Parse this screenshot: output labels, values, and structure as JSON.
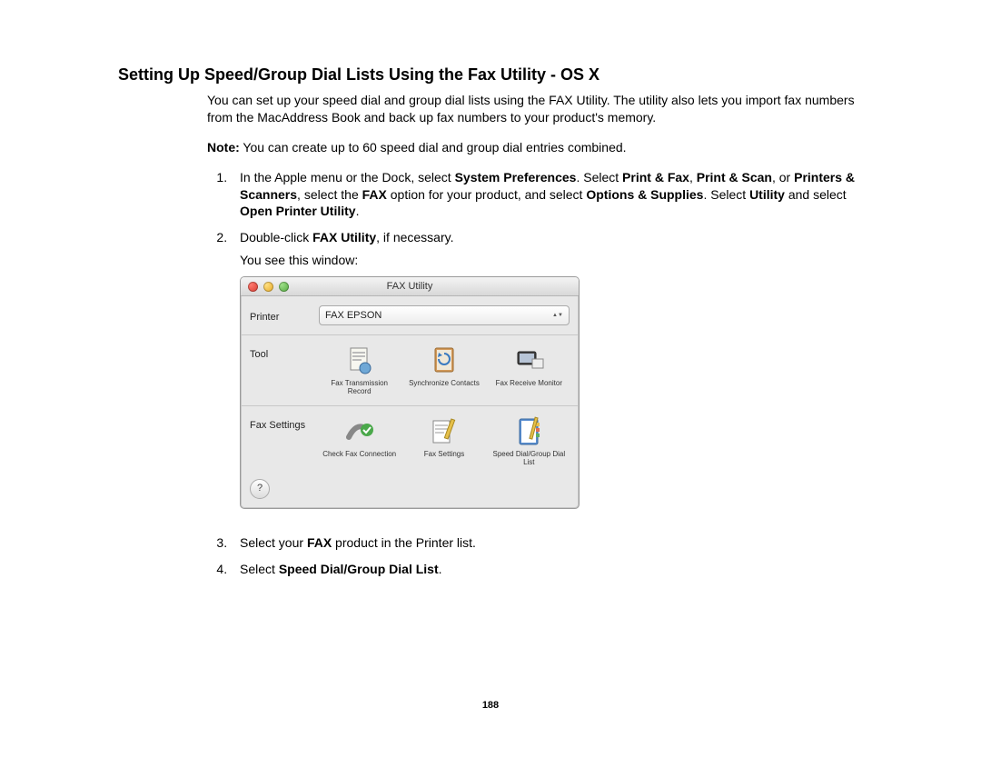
{
  "heading": "Setting Up Speed/Group Dial Lists Using the Fax Utility - OS X",
  "intro": "You can set up your speed dial and group dial lists using the FAX Utility. The utility also lets you import fax numbers from the MacAddress Book and back up fax numbers to your product's memory.",
  "note_label": "Note:",
  "note_text": " You can create up to 60 speed dial and group dial entries combined.",
  "steps": {
    "s1_a": "In the Apple menu or the Dock, select ",
    "s1_b": "System Preferences",
    "s1_c": ". Select ",
    "s1_d": "Print & Fax",
    "s1_e": ", ",
    "s1_f": "Print & Scan",
    "s1_g": ", or ",
    "s1_h": "Printers & Scanners",
    "s1_i": ", select the ",
    "s1_j": "FAX",
    "s1_k": " option for your product, and select ",
    "s1_l": "Options & Supplies",
    "s1_m": ". Select ",
    "s1_n": "Utility",
    "s1_o": " and select ",
    "s1_p": "Open Printer Utility",
    "s1_q": ".",
    "s2_a": "Double-click ",
    "s2_b": "FAX Utility",
    "s2_c": ", if necessary.",
    "s2_sub": "You see this window:",
    "s3_a": "Select your ",
    "s3_b": "FAX",
    "s3_c": " product in the Printer list.",
    "s4_a": "Select ",
    "s4_b": "Speed Dial/Group Dial List",
    "s4_c": "."
  },
  "window": {
    "title": "FAX Utility",
    "printer_label": "Printer",
    "printer_value": "FAX EPSON",
    "tool_label": "Tool",
    "tools": [
      "Fax Transmission Record",
      "Synchronize Contacts",
      "Fax Receive Monitor"
    ],
    "fax_settings_label": "Fax Settings",
    "settings": [
      "Check Fax Connection",
      "Fax Settings",
      "Speed Dial/Group Dial List"
    ],
    "help": "?"
  },
  "page_number": "188"
}
